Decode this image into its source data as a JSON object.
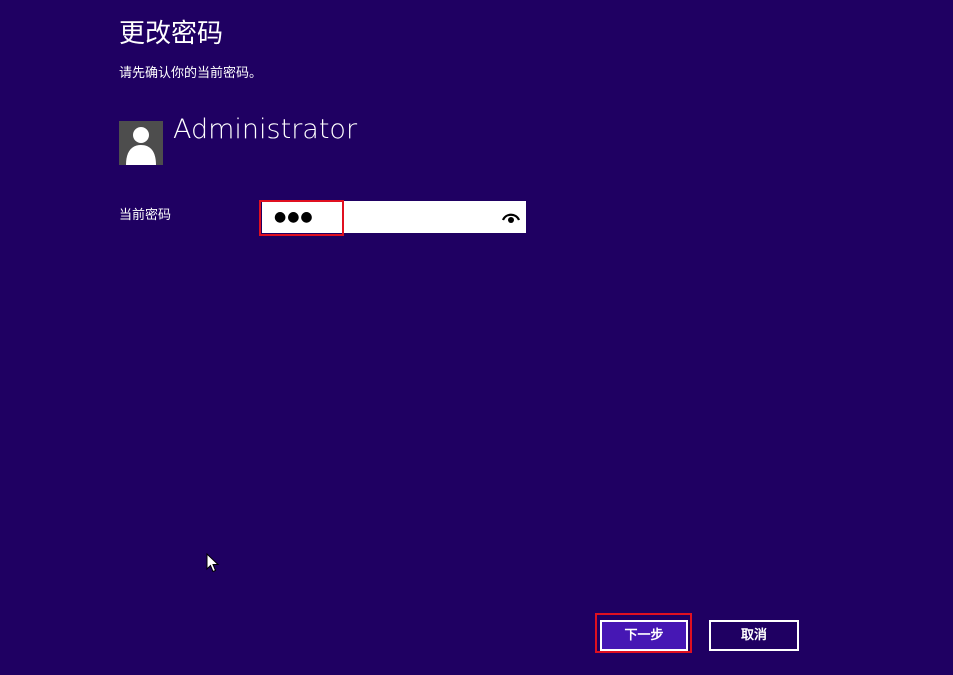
{
  "header": {
    "title": "更改密码",
    "subtitle": "请先确认你的当前密码。"
  },
  "user": {
    "name": "Administrator",
    "avatar_icon": "user-silhouette-icon"
  },
  "form": {
    "current_password_label": "当前密码",
    "current_password_value": "●●●",
    "reveal_icon": "eye-icon"
  },
  "actions": {
    "next_label": "下一步",
    "cancel_label": "取消"
  },
  "colors": {
    "background": "#1f0062",
    "primary_button": "#4617b4",
    "highlight": "#e01020",
    "avatar_bg": "#4d4d4d"
  }
}
